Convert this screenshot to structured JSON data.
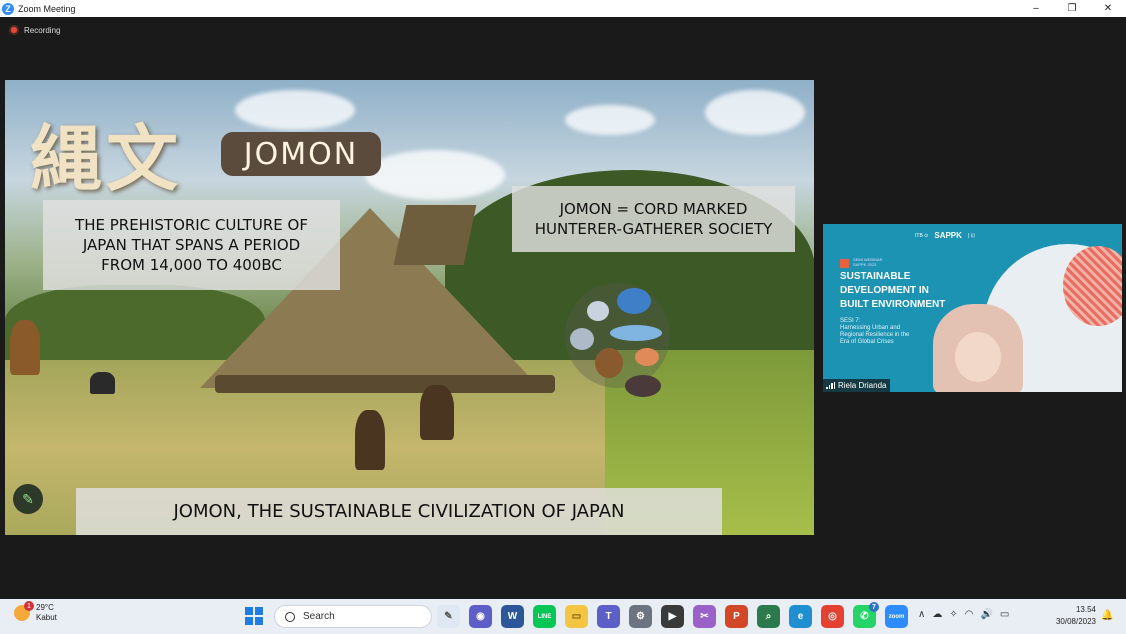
{
  "window": {
    "title": "Zoom Meeting",
    "app_logo": "Z",
    "controls": [
      "–",
      "❐",
      "✕"
    ]
  },
  "meeting": {
    "recording_label": "Recording"
  },
  "slide": {
    "kanji": "縄文",
    "jomon_label": "JOMON",
    "description_lines": [
      "THE PREHISTORIC CULTURE OF",
      "JAPAN THAT SPANS A PERIOD",
      "FROM 14,000 TO 400BC"
    ],
    "cord_lines": [
      "JOMON = CORD MARKED",
      "HUNTERER-GATHERER SOCIETY"
    ],
    "footer": "JOMON, THE SUSTAINABLE CIVILIZATION OF JAPAN",
    "annotate_icon": "pencil-icon"
  },
  "participant": {
    "name": "Riela Drianda",
    "headline_lines": [
      "SUSTAINABLE",
      "DEVELOPMENT IN",
      "BUILT ENVIRONMENT"
    ],
    "sub_lines": [
      "SESI 7:",
      "Harnessing Urban and",
      "Regional Resilience in the",
      "Era of Global Crises"
    ],
    "small_lines": [
      "SEMI WEBINAR",
      "SAPPK 2023"
    ],
    "brand": "SAPPK",
    "logos_left": "ITB ⊙",
    "logos_right": "| ⊡",
    "accent_color": "#1d93b3"
  },
  "taskbar": {
    "weather_badge": "1",
    "temperature": "29°C",
    "weather_desc": "Kabut",
    "search_placeholder": "Search",
    "apps": [
      {
        "name": "widgets",
        "glyph": "✎",
        "color": "#dfe7f2"
      },
      {
        "name": "chat",
        "glyph": "◉",
        "color": "#5b5fc7"
      },
      {
        "name": "word",
        "glyph": "W",
        "color": "#2b579a"
      },
      {
        "name": "line",
        "glyph": "LINE",
        "color": "#06c755"
      },
      {
        "name": "file-explorer",
        "glyph": "▭",
        "color": "#f4c542"
      },
      {
        "name": "teams",
        "glyph": "T",
        "color": "#5b5fc7"
      },
      {
        "name": "settings",
        "glyph": "⚙",
        "color": "#6b7480"
      },
      {
        "name": "media",
        "glyph": "▶",
        "color": "#3a3a3a"
      },
      {
        "name": "snipping",
        "glyph": "✂",
        "color": "#9a62c9"
      },
      {
        "name": "powerpoint",
        "glyph": "P",
        "color": "#d24726"
      },
      {
        "name": "search-app",
        "glyph": "⌕",
        "color": "#2b7a4b"
      },
      {
        "name": "edge",
        "glyph": "e",
        "color": "#1f8fd1"
      },
      {
        "name": "chrome",
        "glyph": "◎",
        "color": "#e44133"
      },
      {
        "name": "whatsapp",
        "glyph": "✆",
        "color": "#25d366",
        "badge": "7"
      },
      {
        "name": "zoom",
        "glyph": "zoom",
        "color": "#2d8cff"
      }
    ],
    "tray_glyphs": [
      "∧",
      "☁",
      "✧",
      "◠",
      "🔊",
      "▭"
    ],
    "time": "13.54",
    "date": "30/08/2023"
  }
}
